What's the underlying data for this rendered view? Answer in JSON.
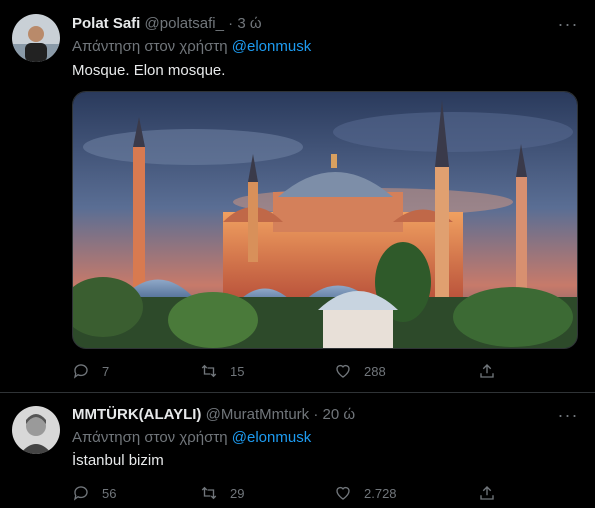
{
  "tweets": [
    {
      "name": "Polat Safi",
      "handle": "@polatsafi_",
      "separator": "·",
      "time": "3 ώ",
      "reply_prefix": "Απάντηση στον χρήστη",
      "reply_to": "@elonmusk",
      "text": "Mosque. Elon mosque.",
      "replies": "7",
      "retweets": "15",
      "likes": "288"
    },
    {
      "name": "MMTÜRK(ALAYLI)",
      "handle": "@MuratMmturk",
      "separator": "·",
      "time": "20 ώ",
      "reply_prefix": "Απάντηση στον χρήστη",
      "reply_to": "@elonmusk",
      "text": "İstanbul bizim",
      "replies": "56",
      "retweets": "29",
      "likes": "2.728"
    }
  ],
  "icons": {
    "more": "more-dots-icon",
    "reply": "reply-icon",
    "retweet": "retweet-icon",
    "like": "heart-icon",
    "share": "share-icon"
  },
  "colors": {
    "background": "#000000",
    "link": "#1d9bf0",
    "muted": "#71767b",
    "text": "#e7e9ea"
  }
}
